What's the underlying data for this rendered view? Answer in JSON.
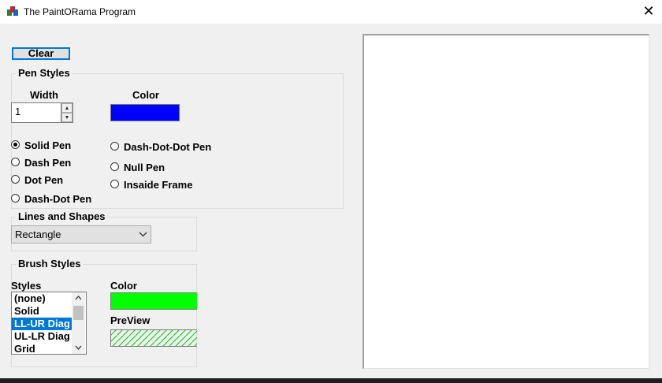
{
  "window": {
    "title": "The PaintORama Program",
    "close_glyph": "✕"
  },
  "clear_button": "Clear",
  "pen_styles": {
    "group_title": "Pen Styles",
    "width_label": "Width",
    "width_value": "1",
    "color_label": "Color",
    "color": "#0000ff",
    "options": [
      "Solid Pen",
      "Dash Pen",
      "Dot Pen",
      "Dash-Dot Pen",
      "Dash-Dot-Dot Pen",
      "Null Pen",
      "Insaide Frame"
    ],
    "selected": "Solid Pen"
  },
  "lines_and_shapes": {
    "group_title": "Lines and Shapes",
    "selected": "Rectangle"
  },
  "brush_styles": {
    "group_title": "Brush Styles",
    "styles_label": "Styles",
    "styles": [
      "(none)",
      "Solid",
      "LL-UR Diag",
      "UL-LR Diag",
      "Grid"
    ],
    "selected_style": "LL-UR Diag",
    "color_label": "Color",
    "color": "#00ff00",
    "preview_label": "PreView"
  },
  "icons": {
    "app": "paint-app-icon",
    "close": "close-icon",
    "spin_up": "up-arrow-icon",
    "spin_down": "down-arrow-icon",
    "dropdown": "chevron-down-icon"
  }
}
